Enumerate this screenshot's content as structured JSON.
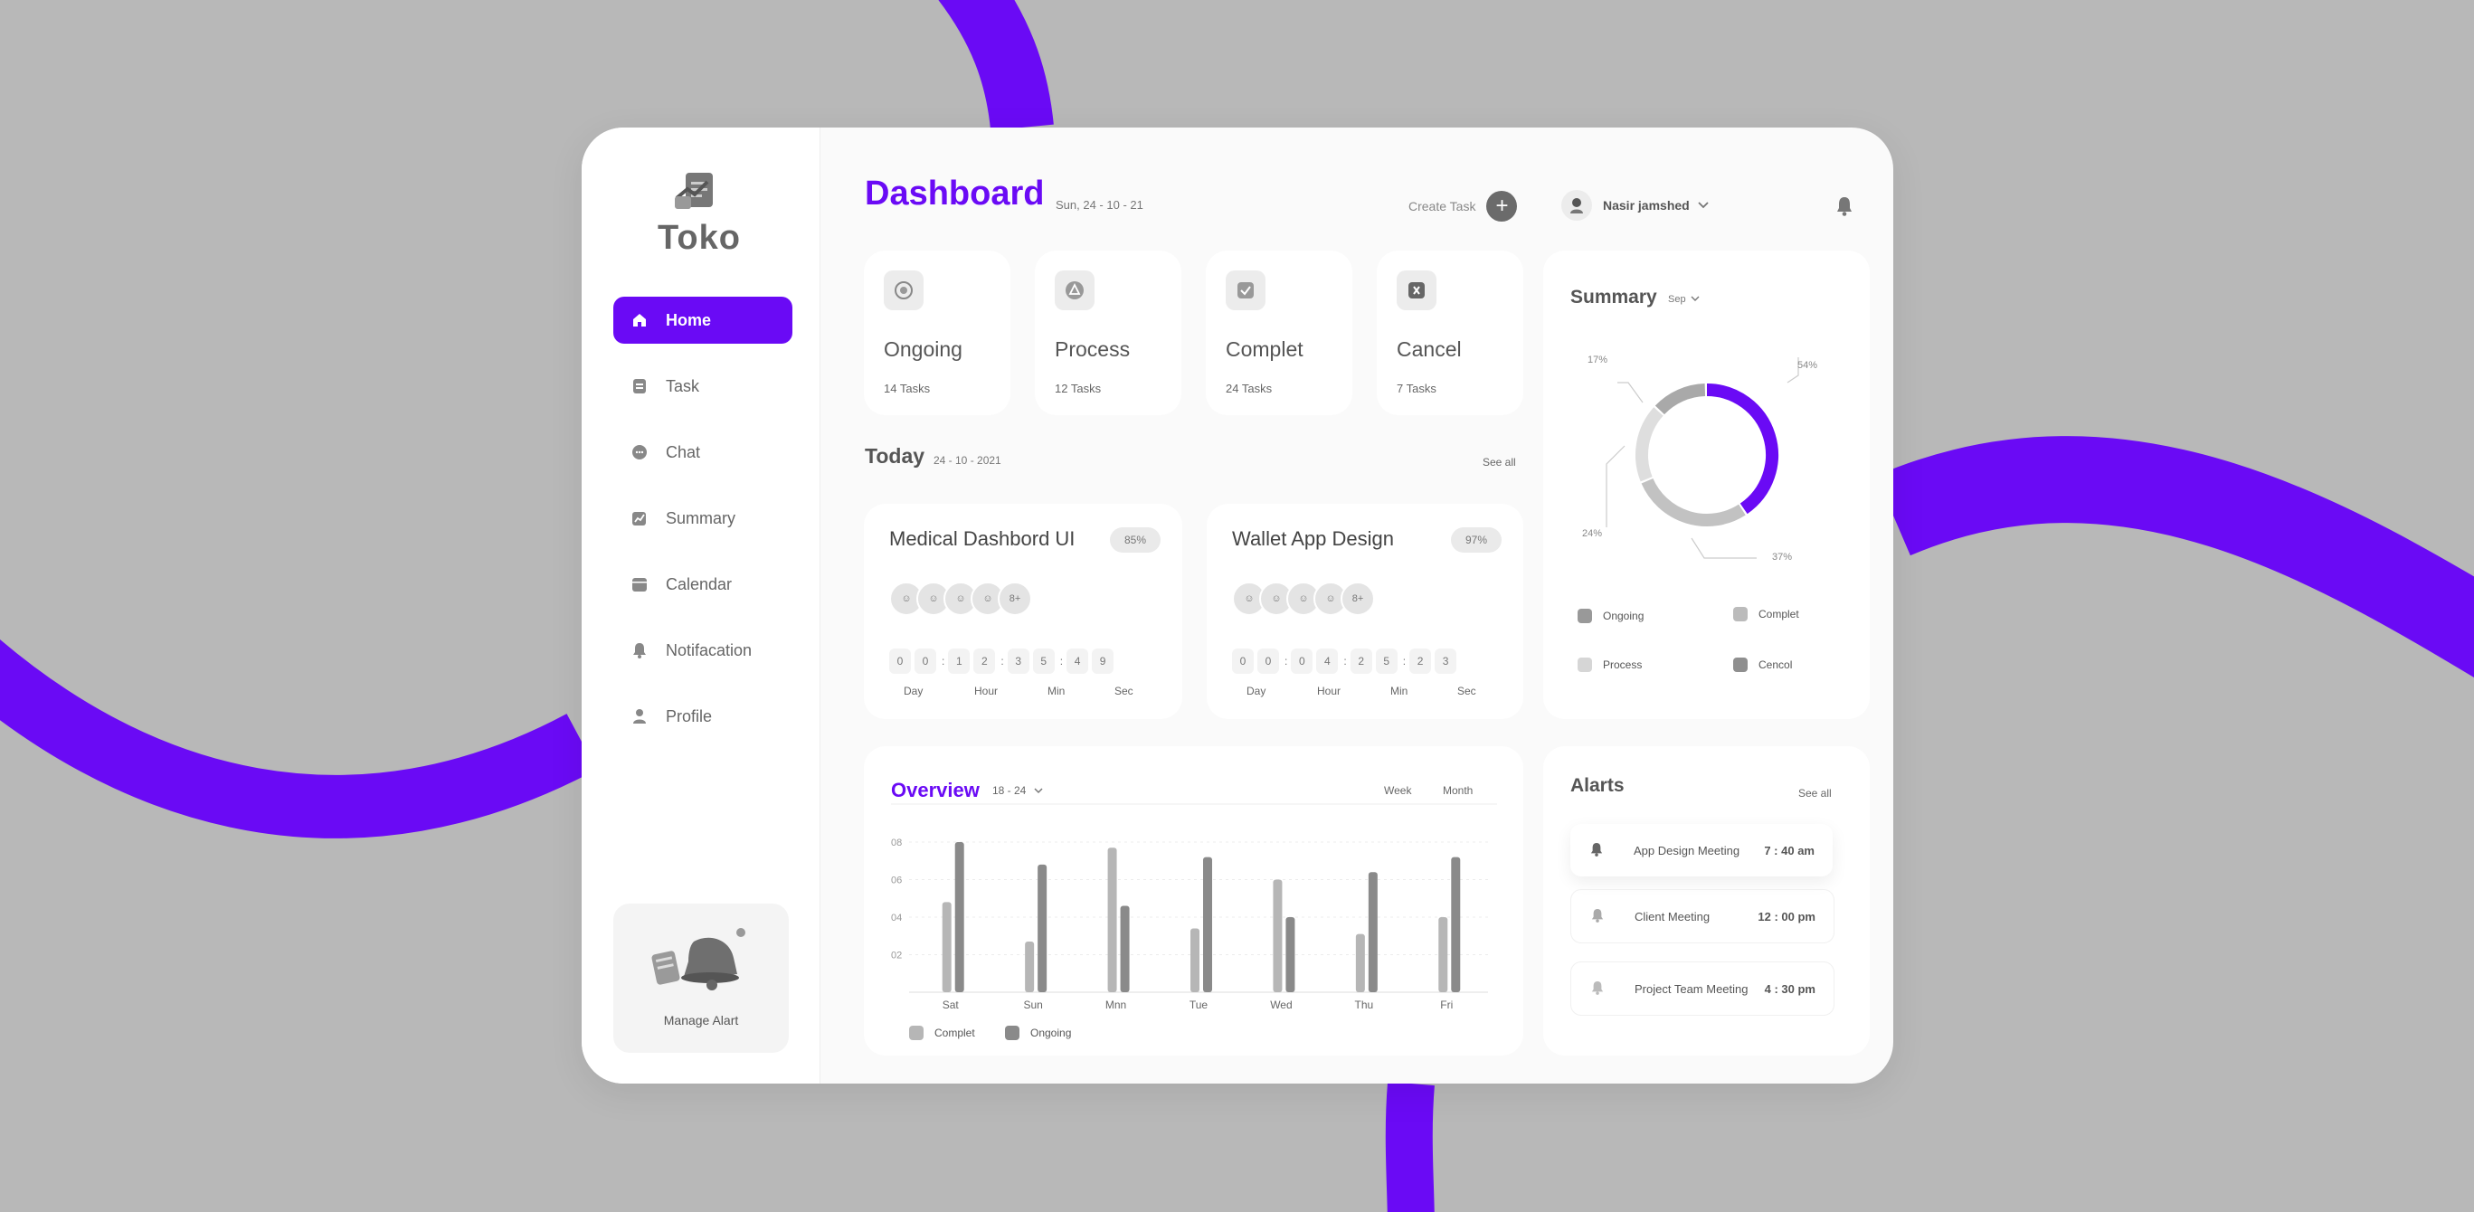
{
  "brand": {
    "name": "Toko",
    "accent": "#6a0af5"
  },
  "sidebar": {
    "items": [
      {
        "label": "Home",
        "icon": "home-icon"
      },
      {
        "label": "Task",
        "icon": "task-icon"
      },
      {
        "label": "Chat",
        "icon": "chat-icon"
      },
      {
        "label": "Summary",
        "icon": "summary-icon"
      },
      {
        "label": "Calendar",
        "icon": "calendar-icon"
      },
      {
        "label": "Notifacation",
        "icon": "bell-icon"
      },
      {
        "label": "Profile",
        "icon": "profile-icon"
      }
    ],
    "manage_label": "Manage Alart"
  },
  "header": {
    "title": "Dashboard",
    "date": "Sun, 24 - 10 - 21",
    "create_label": "Create Task",
    "user_name": "Nasir jamshed"
  },
  "stats": [
    {
      "name": "Ongoing",
      "count": "14 Tasks"
    },
    {
      "name": "Process",
      "count": "12 Tasks"
    },
    {
      "name": "Complet",
      "count": "24 Tasks"
    },
    {
      "name": "Cancel",
      "count": "7 Tasks"
    }
  ],
  "today": {
    "title": "Today",
    "date": "24 - 10 - 2021",
    "see_all": "See all",
    "projects": [
      {
        "name": "Medical Dashbord UI",
        "percent": "85%",
        "extra": "8+",
        "digits": [
          "0",
          "0",
          "1",
          "2",
          "3",
          "5",
          "4",
          "9"
        ],
        "units": [
          "Day",
          "Hour",
          "Min",
          "Sec"
        ]
      },
      {
        "name": "Wallet App Design",
        "percent": "97%",
        "extra": "8+",
        "digits": [
          "0",
          "0",
          "0",
          "4",
          "2",
          "5",
          "2",
          "3"
        ],
        "units": [
          "Day",
          "Hour",
          "Min",
          "Sec"
        ]
      }
    ]
  },
  "overview": {
    "title": "Overview",
    "range": "18 - 24",
    "tabs": [
      "Week",
      "Month"
    ],
    "legend": [
      "Complet",
      "Ongoing"
    ]
  },
  "summary": {
    "title": "Summary",
    "select": "Sep",
    "legend": [
      "Ongoing",
      "Complet",
      "Process",
      "Cencol"
    ]
  },
  "alerts": {
    "title": "Alarts",
    "see_all": "See all",
    "items": [
      {
        "label": "App Design Meeting",
        "time": "7 : 40 am"
      },
      {
        "label": "Client Meeting",
        "time": "12 : 00 pm"
      },
      {
        "label": "Project Team Meeting",
        "time": "4 : 30 pm"
      }
    ]
  },
  "chart_data": [
    {
      "type": "bar",
      "categories": [
        "Sat",
        "Sun",
        "Mnn",
        "Tue",
        "Wed",
        "Thu",
        "Fri"
      ],
      "series": [
        {
          "name": "Complet",
          "values": [
            4.8,
            2.7,
            7.7,
            3.4,
            6.0,
            3.1,
            4.0
          ],
          "color": "#b6b6b6"
        },
        {
          "name": "Ongoing",
          "values": [
            8.0,
            6.8,
            4.6,
            7.2,
            4.0,
            6.4,
            7.2
          ],
          "color": "#8a8a8a"
        }
      ],
      "yticks": [
        "08",
        "06",
        "04",
        "02"
      ],
      "ylim": [
        0,
        8
      ]
    },
    {
      "type": "pie",
      "labels": [
        "54%",
        "37%",
        "24%",
        "17%"
      ],
      "values": [
        54,
        37,
        24,
        17
      ],
      "colors": [
        "#6a0af5",
        "#c2c2c2",
        "#dedede",
        "#a9a9a9"
      ]
    }
  ]
}
